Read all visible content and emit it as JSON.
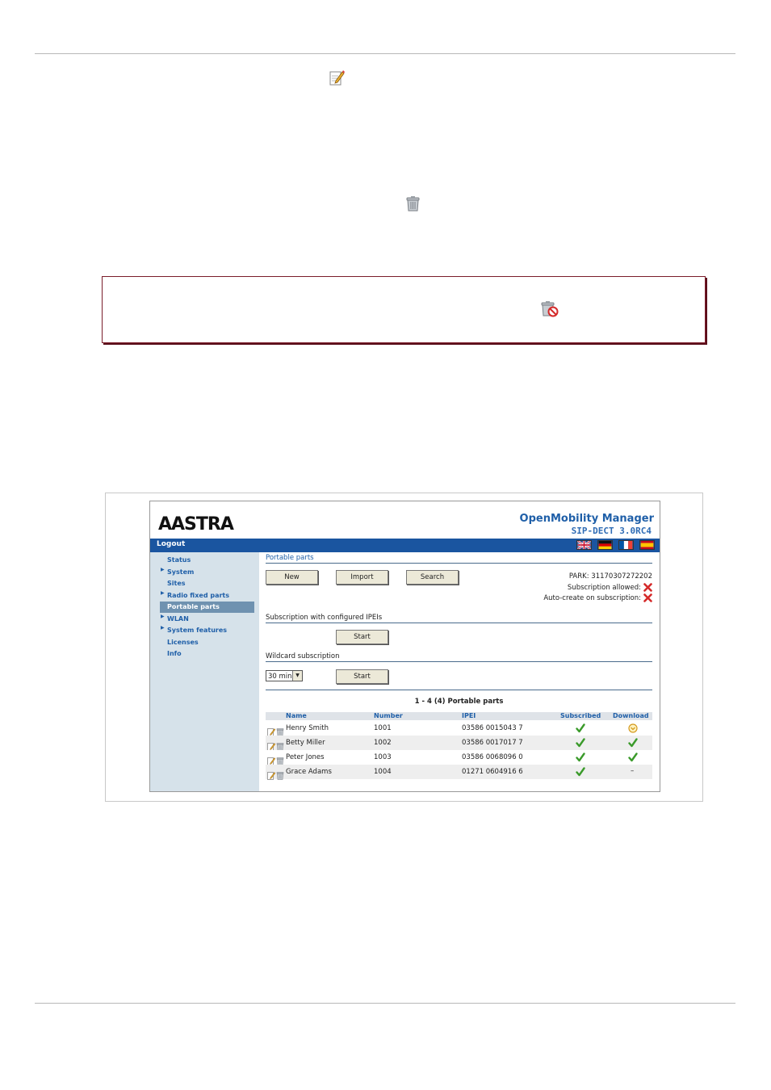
{
  "app": {
    "logo": "AASTRA",
    "title": "OpenMobility Manager",
    "subtitle": "SIP-DECT 3.0RC4",
    "logout": "Logout"
  },
  "sidebar": {
    "items": [
      {
        "label": "Status",
        "arrow": false
      },
      {
        "label": "System",
        "arrow": true
      },
      {
        "label": "Sites",
        "arrow": false
      },
      {
        "label": "Radio fixed parts",
        "arrow": true
      },
      {
        "label": "Portable parts",
        "arrow": false,
        "active": true
      },
      {
        "label": "WLAN",
        "arrow": true
      },
      {
        "label": "System features",
        "arrow": true
      },
      {
        "label": "Licenses",
        "arrow": false
      },
      {
        "label": "Info",
        "arrow": false
      }
    ]
  },
  "main": {
    "section_title": "Portable parts",
    "buttons": {
      "new": "New",
      "import": "Import",
      "search": "Search"
    },
    "park": "PARK: 31170307272202",
    "subscription_allowed": "Subscription allowed:",
    "auto_create": "Auto-create on subscription:",
    "configured_title": "Subscription with configured IPEIs",
    "configured_start": "Start",
    "wildcard_title": "Wildcard subscription",
    "wildcard_select": "30 min",
    "wildcard_start": "Start",
    "count": "1 - 4 (4) Portable parts"
  },
  "table": {
    "headers": {
      "name": "Name",
      "number": "Number",
      "ipei": "IPEI",
      "subscribed": "Subscribed",
      "download": "Download"
    },
    "rows": [
      {
        "name": "Henry Smith",
        "number": "1001",
        "ipei": "03586 0015043 7",
        "subscribed": "check",
        "download": "pending"
      },
      {
        "name": "Betty Miller",
        "number": "1002",
        "ipei": "03586 0017017 7",
        "subscribed": "check",
        "download": "check"
      },
      {
        "name": "Peter Jones",
        "number": "1003",
        "ipei": "03586 0068096 0",
        "subscribed": "check",
        "download": "check"
      },
      {
        "name": "Grace Adams",
        "number": "1004",
        "ipei": "01271 0604916 6",
        "subscribed": "check",
        "download": "–"
      }
    ]
  },
  "colors": {
    "accent": "#1a55a0",
    "sidebar": "#d6e2ea",
    "note_border": "#7a1c2a",
    "check": "#3a9a2a",
    "cross": "#d42a2a"
  }
}
